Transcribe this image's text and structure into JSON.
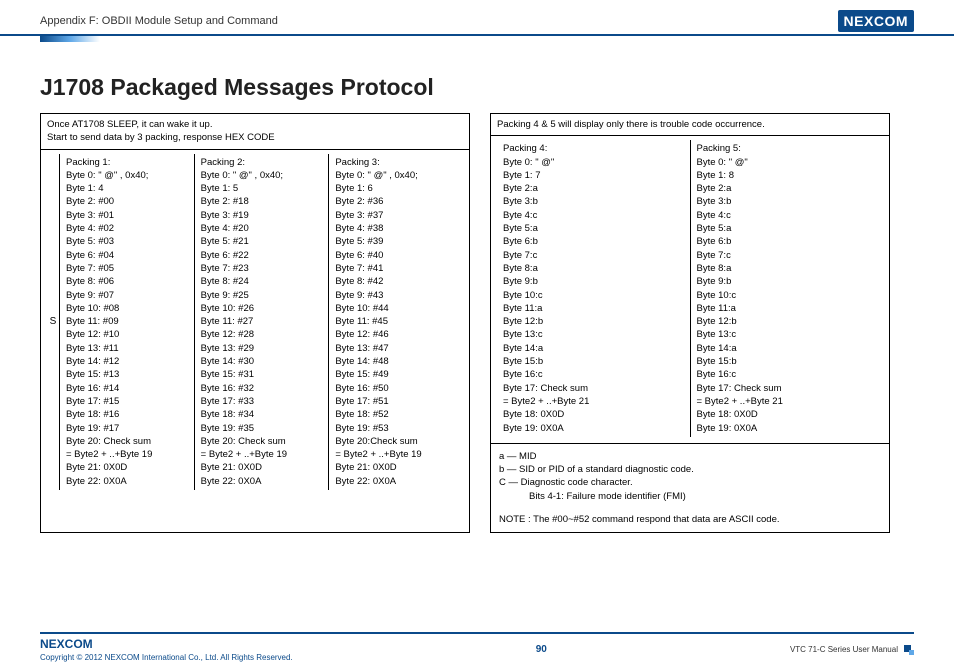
{
  "header": {
    "appendix": "Appendix F: OBDII Module Setup and Command",
    "logo": "NEXCOM"
  },
  "title": "J1708 Packaged Messages Protocol",
  "box1": {
    "top_line1": "Once AT1708 SLEEP, it can wake it up.",
    "top_line2": "Start to send data by 3 packing, response HEX CODE",
    "s_label": "S",
    "packing1": [
      "Packing 1:",
      "Byte 0: \" @\" , 0x40;",
      "Byte 1: 4",
      "Byte 2: #00",
      "Byte 3: #01",
      "Byte 4: #02",
      "Byte 5: #03",
      "Byte 6: #04",
      "Byte 7: #05",
      "Byte 8: #06",
      "Byte 9: #07",
      "Byte 10: #08",
      "Byte 11: #09",
      "Byte 12: #10",
      "Byte 13: #11",
      "Byte 14: #12",
      "Byte 15: #13",
      "Byte 16: #14",
      "Byte 17: #15",
      "Byte 18: #16",
      "Byte 19: #17",
      "Byte 20: Check sum",
      "= Byte2 + ..+Byte 19",
      "Byte 21: 0X0D",
      "Byte 22: 0X0A"
    ],
    "packing2": [
      "Packing 2:",
      "Byte 0: \" @\" , 0x40;",
      "Byte 1: 5",
      "Byte 2: #18",
      "Byte 3: #19",
      "Byte 4: #20",
      "Byte 5: #21",
      "Byte 6: #22",
      "Byte 7: #23",
      "Byte 8: #24",
      "Byte 9: #25",
      "Byte 10: #26",
      "Byte 11: #27",
      "Byte 12: #28",
      "Byte 13: #29",
      "Byte 14: #30",
      "Byte 15: #31",
      "Byte 16: #32",
      "Byte 17: #33",
      "Byte 18: #34",
      "Byte 19: #35",
      "Byte 20: Check sum",
      "= Byte2 + ..+Byte 19",
      "Byte 21: 0X0D",
      "Byte 22: 0X0A"
    ],
    "packing3": [
      "Packing 3:",
      "Byte 0: \" @\" , 0x40;",
      "Byte 1: 6",
      "Byte 2: #36",
      "Byte 3: #37",
      "Byte 4: #38",
      "Byte 5: #39",
      "Byte 6: #40",
      "Byte 7: #41",
      "Byte 8: #42",
      "Byte 9: #43",
      "Byte 10: #44",
      "Byte 11: #45",
      "Byte 12: #46",
      "Byte 13: #47",
      "Byte 14: #48",
      "Byte 15: #49",
      "Byte 16: #50",
      "Byte 17: #51",
      "Byte 18: #52",
      "Byte 19: #53",
      "Byte 20:Check sum",
      "= Byte2 + ..+Byte 19",
      "Byte 21: 0X0D",
      "Byte 22: 0X0A"
    ]
  },
  "box2": {
    "top_line1": "Packing 4 & 5 will display only there is trouble code occurrence.",
    "packing4": [
      "Packing 4:",
      "Byte 0: \" @\"",
      "Byte 1: 7",
      "Byte 2:a",
      "Byte 3:b",
      "Byte 4:c",
      "Byte 5:a",
      "Byte 6:b",
      "Byte 7:c",
      "Byte 8:a",
      "Byte 9:b",
      "Byte 10:c",
      "Byte 11:a",
      "Byte 12:b",
      "Byte 13:c",
      "Byte 14:a",
      "Byte 15:b",
      "Byte 16:c",
      "Byte 17: Check sum",
      "= Byte2 + ..+Byte 21",
      "Byte 18: 0X0D",
      "Byte 19: 0X0A"
    ],
    "packing5": [
      "Packing 5:",
      "Byte 0: \" @\"",
      "Byte 1: 8",
      "Byte 2:a",
      "Byte 3:b",
      "Byte 4:c",
      "Byte 5:a",
      "Byte 6:b",
      "Byte 7:c",
      "Byte 8:a",
      "Byte 9:b",
      "Byte 10:c",
      "Byte 11:a",
      "Byte 12:b",
      "Byte 13:c",
      "Byte 14:a",
      "Byte 15:b",
      "Byte 16:c",
      "Byte 17: Check sum",
      "= Byte2 + ..+Byte 21",
      "Byte 18: 0X0D",
      "Byte 19: 0X0A"
    ],
    "legend_a": "a — MID",
    "legend_b": "b — SID or PID of a standard diagnostic code.",
    "legend_c": "C — Diagnostic code character.",
    "legend_c2": "Bits 4-1: Failure mode identifier (FMI)",
    "note": "NOTE : The #00~#52 command respond that data are ASCII code."
  },
  "footer": {
    "logo": "NEXCOM",
    "copyright": "Copyright © 2012 NEXCOM International Co., Ltd. All Rights Reserved.",
    "page": "90",
    "manual": "VTC 71-C Series User Manual"
  }
}
